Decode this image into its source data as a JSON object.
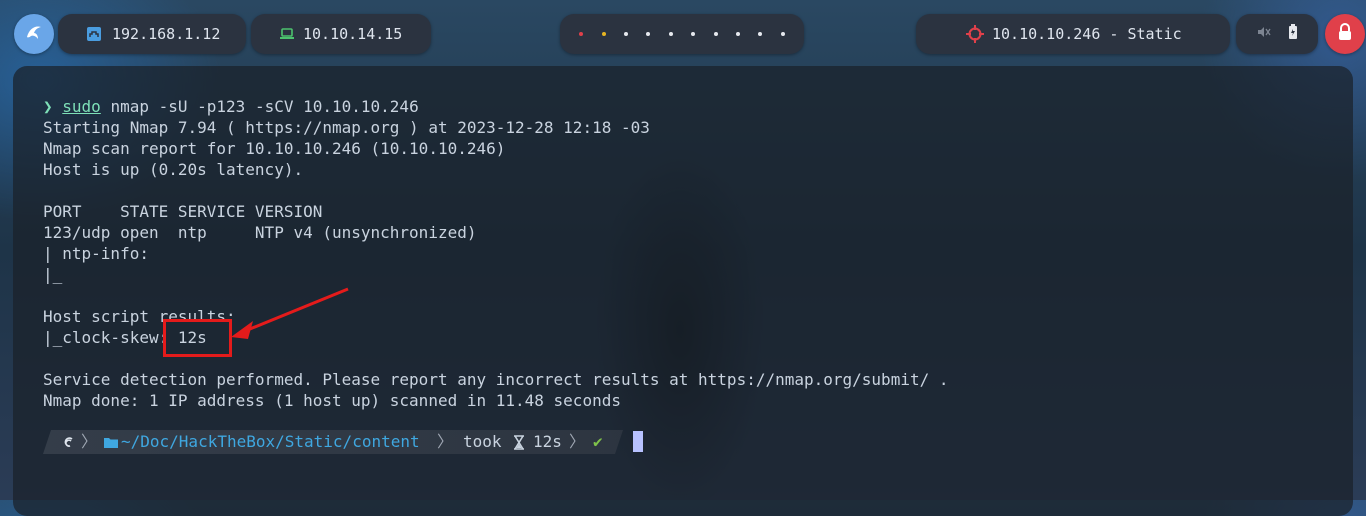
{
  "topbar": {
    "ip_local": "192.168.1.12",
    "ip_vpn": "10.10.14.15",
    "workspace_count": 10,
    "target_label": "10.10.10.246 - Static",
    "colors": {
      "pill_bg": "#2b3340",
      "lock_bg": "#e0404a",
      "target_icon": "#e0404a",
      "vpn_icon": "#4cc26e",
      "lan_icon": "#4a9de0"
    }
  },
  "terminal": {
    "prompt_symbol": "❯",
    "cmd_sudo": "sudo",
    "cmd_rest": " nmap -sU -p123 -sCV 10.10.10.246",
    "lines": [
      "Starting Nmap 7.94 ( https://nmap.org ) at 2023-12-28 12:18 -03",
      "Nmap scan report for 10.10.10.246 (10.10.10.246)",
      "Host is up (0.20s latency).",
      "",
      "PORT    STATE SERVICE VERSION",
      "123/udp open  ntp     NTP v4 (unsynchronized)",
      "| ntp-info: ",
      "|_",
      "",
      "Host script results:",
      "|_clock-skew: 12s",
      "",
      "Service detection performed. Please report any incorrect results at https://nmap.org/submit/ .",
      "Nmap done: 1 IP address (1 host up) scanned in 11.48 seconds"
    ],
    "prompt_path_prefix": "~/Doc/HackTheBox/Static/",
    "prompt_path_dir": "content",
    "took_label": "took",
    "took_value": "12s",
    "status_check": "✔"
  }
}
